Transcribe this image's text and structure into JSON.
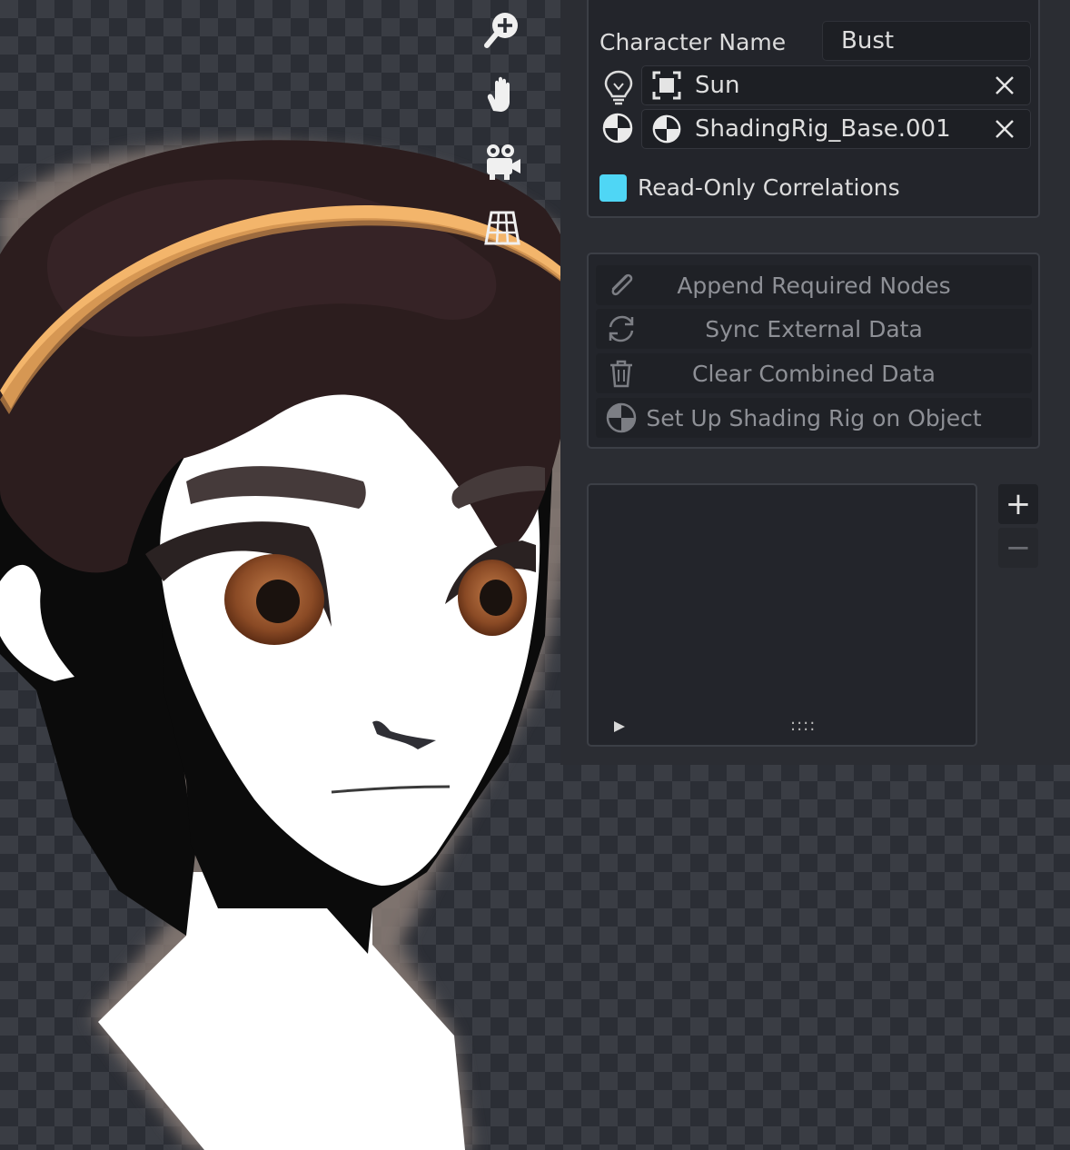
{
  "panel": {
    "character_name_label": "Character Name",
    "character_name_value": "Bust",
    "light_ref": {
      "icon": "light-bulb-icon",
      "object_icon": "light-object-icon",
      "value": "Sun"
    },
    "shading_rig_ref": {
      "icon": "shading-rig-icon",
      "object_icon": "shading-rig-icon",
      "value": "ShadingRig_Base.001"
    },
    "read_only_checkbox": {
      "label": "Read-Only Correlations",
      "checked": true,
      "color": "#4fd6f5"
    }
  },
  "operators": [
    {
      "label": "Append Required Nodes",
      "icon": "paperclip-icon"
    },
    {
      "label": "Sync External Data",
      "icon": "sync-icon"
    },
    {
      "label": "Clear Combined Data",
      "icon": "trash-icon"
    },
    {
      "label": "Set Up Shading Rig on Object",
      "icon": "shading-rig-icon"
    }
  ],
  "list_panel": {
    "expand_icon": "play-triangle-icon",
    "grip_text": "::::",
    "add_label": "+",
    "remove_label": "−"
  },
  "viewport_nav": [
    "zoom-icon",
    "hand-pan-icon",
    "camera-icon",
    "perspective-grid-icon"
  ]
}
